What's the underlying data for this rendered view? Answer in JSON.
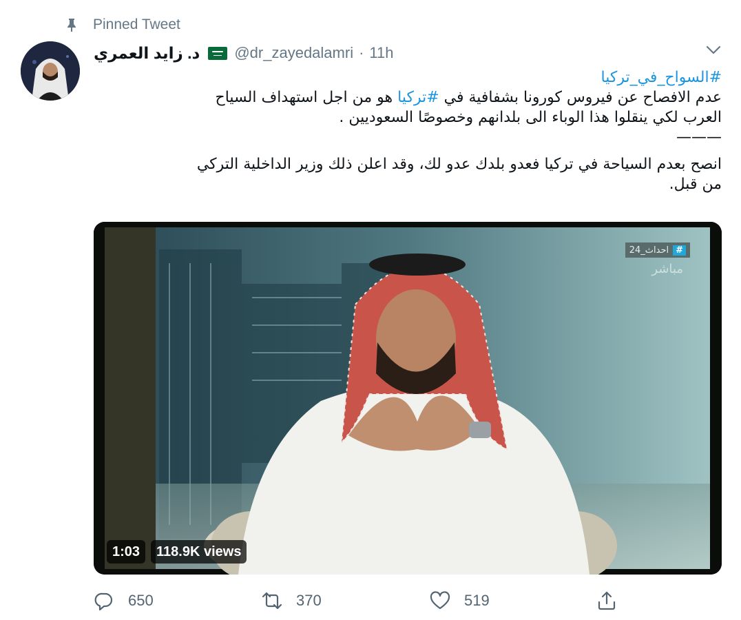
{
  "pinned": {
    "label": "Pinned Tweet"
  },
  "author": {
    "display_name": "د. زايد العمري",
    "handle": "@dr_zayedalamri",
    "separator": "·",
    "time": "11h"
  },
  "tweet": {
    "hashtag_top": "#السواح_في_تركيا",
    "line1_pre": "عدم الافصاح عن فيروس كورونا بشفافية في ",
    "line1_hashtag": "#تركيا",
    "line1_post": " هو من اجل استهداف السياح",
    "line2": "العرب لكي ينقلوا هذا الوباء الى بلدانهم وخصوصًا السعوديين .",
    "divider": "———",
    "line3": "انصح بعدم السياحة في تركيا فعدو بلدك عدو لك، وقد اعلن ذلك وزير الداخلية التركي",
    "line4": "من قبل."
  },
  "video": {
    "duration": "1:03",
    "views": "118.9K views",
    "channel_tag": "#",
    "channel_name": "احداث_24",
    "live_label": "مباشر"
  },
  "actions": {
    "replies": "650",
    "retweets": "370",
    "likes": "519"
  },
  "colors": {
    "link": "#1b95e0",
    "secondary_text": "#657786",
    "action_text": "#536471"
  },
  "icons": [
    "pin-icon",
    "saudi-flag-icon",
    "chevron-down-icon",
    "reply-icon",
    "retweet-icon",
    "like-icon",
    "share-icon"
  ]
}
